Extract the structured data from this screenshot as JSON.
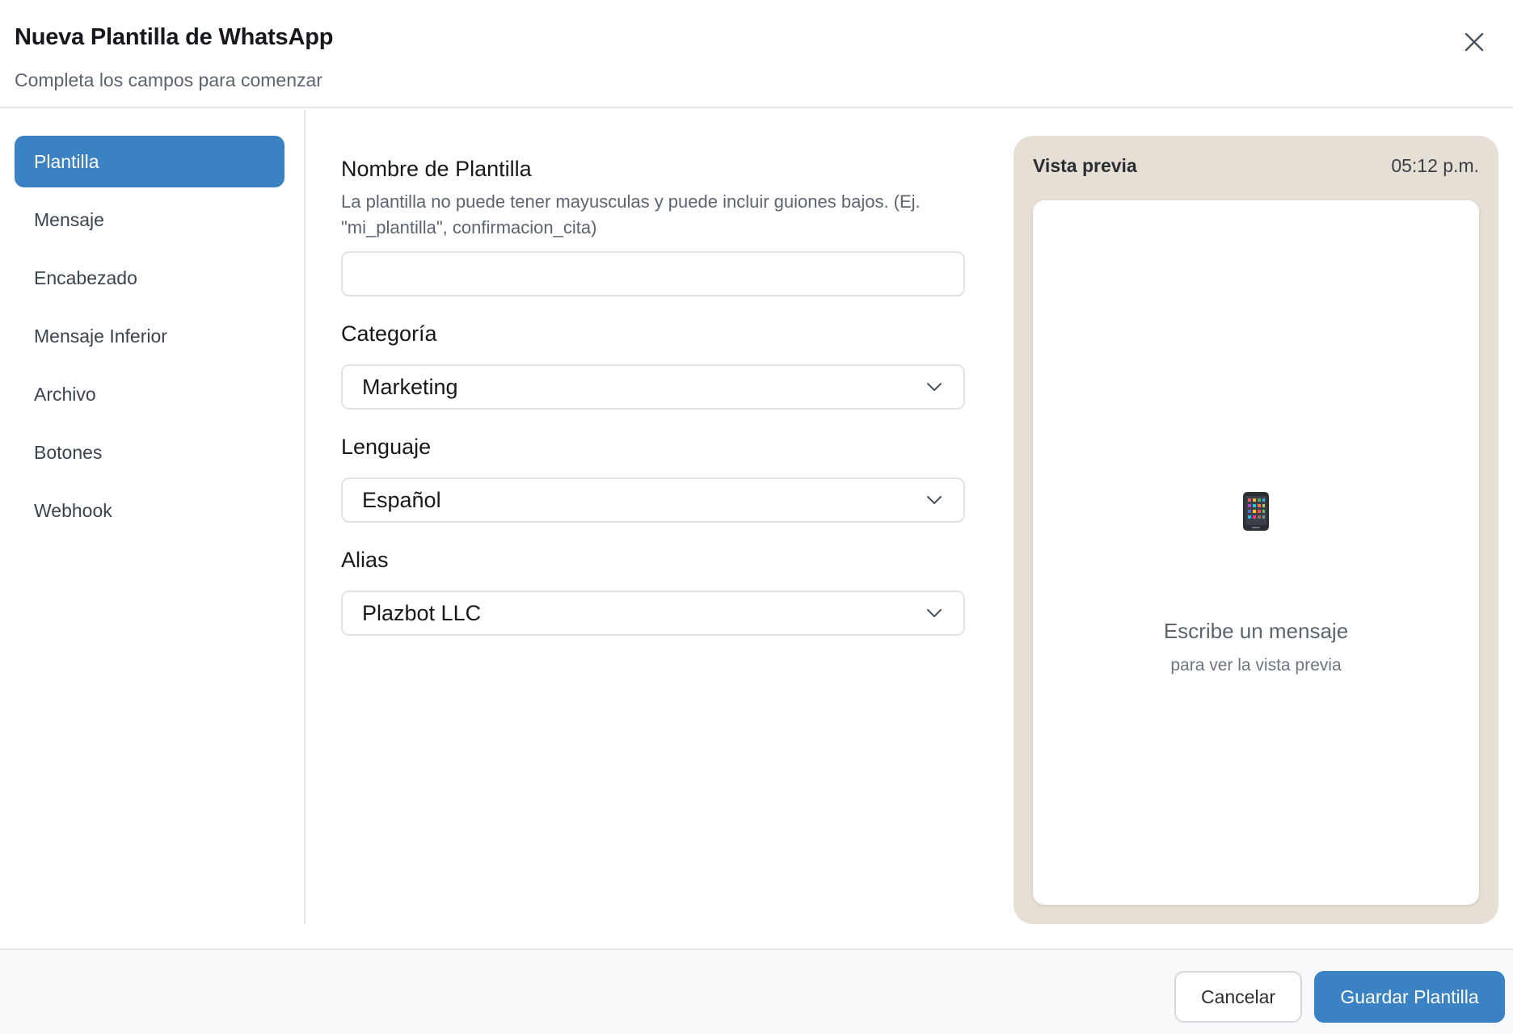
{
  "header": {
    "title": "Nueva Plantilla de WhatsApp",
    "subtitle": "Completa los campos para comenzar",
    "close_icon": "close-icon"
  },
  "sidebar": {
    "items": [
      {
        "label": "Plantilla",
        "active": true
      },
      {
        "label": "Mensaje",
        "active": false
      },
      {
        "label": "Encabezado",
        "active": false
      },
      {
        "label": "Mensaje Inferior",
        "active": false
      },
      {
        "label": "Archivo",
        "active": false
      },
      {
        "label": "Botones",
        "active": false
      },
      {
        "label": "Webhook",
        "active": false
      }
    ]
  },
  "form": {
    "name": {
      "label": "Nombre de Plantilla",
      "hint": "La plantilla no puede tener mayusculas y puede incluir guiones bajos. (Ej. \"mi_plantilla\", confirmacion_cita)",
      "value": "",
      "placeholder": ""
    },
    "category": {
      "label": "Categoría",
      "value": "Marketing"
    },
    "language": {
      "label": "Lenguaje",
      "value": "Español"
    },
    "alias": {
      "label": "Alias",
      "value": "Plazbot LLC"
    }
  },
  "preview": {
    "title": "Vista previa",
    "time": "05:12 p.m.",
    "icon": "mobile-phone-icon",
    "message": "Escribe un mensaje",
    "submessage": "para ver la vista previa"
  },
  "footer": {
    "cancel_label": "Cancelar",
    "save_label": "Guardar Plantilla"
  },
  "colors": {
    "accent": "#3b82c4",
    "preview_bg": "#e6dfd6"
  }
}
